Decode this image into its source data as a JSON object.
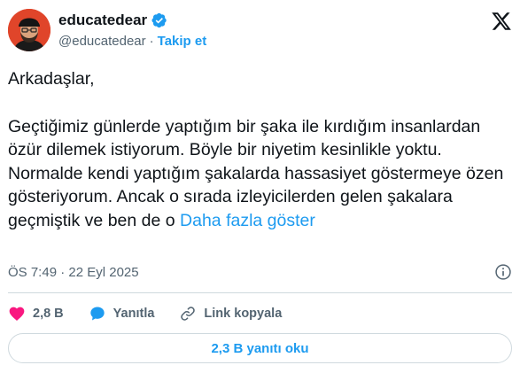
{
  "author": {
    "display_name": "educatedear",
    "handle": "@educatedear",
    "separator": "·",
    "follow_label": "Takip et",
    "verified": true
  },
  "tweet": {
    "greeting": "Arkadaşlar,",
    "body": "Geçtiğimiz günlerde yaptığım bir şaka ile kırdığım insanlardan özür dilemek istiyorum. Böyle bir niyetim kesinlikle yoktu. Normalde kendi yaptığım şakalarda hassasiyet göstermeye özen gösteriyorum. Ancak o sırada izleyicilerden gelen şakalara geçmiştik ve ben de o",
    "show_more_label": "Daha fazla göster",
    "timestamp": "ÖS 7:49 · 22 Eyl 2025"
  },
  "actions": {
    "like_count": "2,8 B",
    "reply_label": "Yanıtla",
    "copy_link_label": "Link kopyala"
  },
  "replies_button_label": "2,3 B yanıtı oku",
  "icons": {
    "verified": "verified-badge-icon",
    "x_logo": "x-logo-icon",
    "info": "info-icon",
    "like": "heart-icon",
    "reply": "speech-bubble-icon",
    "copy_link": "link-icon"
  },
  "colors": {
    "accent": "#1d9bf0",
    "like": "#f91880",
    "text_primary": "#0f1419",
    "text_secondary": "#536471",
    "border": "#cfd9de",
    "avatar_bg": "#e0452a"
  }
}
